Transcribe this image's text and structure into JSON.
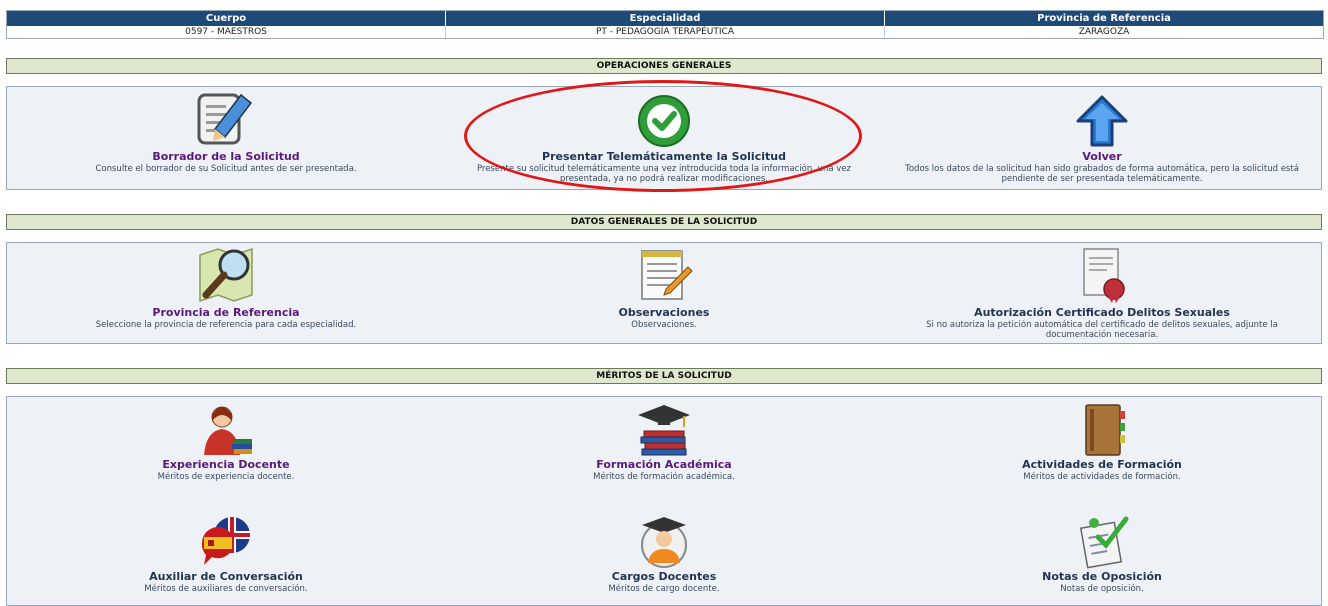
{
  "header": {
    "columns": [
      "Cuerpo",
      "Especialidad",
      "Provincia de Referencia"
    ],
    "values": [
      "0597 - MAESTROS",
      "PT - PEDAGOGÍA TERAPÉUTICA",
      "ZARAGOZA"
    ]
  },
  "sections": {
    "general": "OPERACIONES GENERALES",
    "datos": "DATOS GENERALES DE LA SOLICITUD",
    "meritos": "MÉRITOS DE LA SOLICITUD"
  },
  "general": [
    {
      "title": "Borrador de la Solicitud",
      "desc": "Consulte el borrador de su Solicitud antes de ser presentada.",
      "icon": "edit-document-icon"
    },
    {
      "title": "Presentar Telemáticamente la Solicitud",
      "desc": "Presente su solicitud telemáticamente una vez introducida toda la información, una vez presentada, ya no podrá realizar modificaciones.",
      "icon": "check-circle-icon"
    },
    {
      "title": "Volver",
      "desc": "Todos los datos de la solicitud han sido grabados de forma automática, pero la solicitud está pendiente de ser presentada telemáticamente.",
      "icon": "arrow-up-icon"
    }
  ],
  "datos": [
    {
      "title": "Provincia de Referencia",
      "desc": "Seleccione la provincia de referencia para cada especialidad.",
      "icon": "map-magnifier-icon"
    },
    {
      "title": "Observaciones",
      "desc": "Observaciones.",
      "icon": "notepad-pencil-icon"
    },
    {
      "title": "Autorización Certificado Delitos Sexuales",
      "desc": "Si no autoriza la petición automática del certificado de delitos sexuales, adjunte la documentación necesaria.",
      "icon": "certificate-seal-icon"
    }
  ],
  "meritos": [
    {
      "title": "Experiencia Docente",
      "desc": "Méritos de experiencia docente.",
      "icon": "teacher-books-icon"
    },
    {
      "title": "Formación Académica",
      "desc": "Méritos de formación académica.",
      "icon": "graduation-books-icon"
    },
    {
      "title": "Actividades de Formación",
      "desc": "Méritos de actividades de formación.",
      "icon": "notebook-icon"
    },
    {
      "title": "Auxiliar de Conversación",
      "desc": "Méritos de auxiliares de conversación.",
      "icon": "flags-speech-icon"
    },
    {
      "title": "Cargos Docentes",
      "desc": "Méritos de cargo docente.",
      "icon": "graduate-person-icon"
    },
    {
      "title": "Notas de Oposición",
      "desc": "Notas de oposición.",
      "icon": "checklist-icon"
    }
  ]
}
